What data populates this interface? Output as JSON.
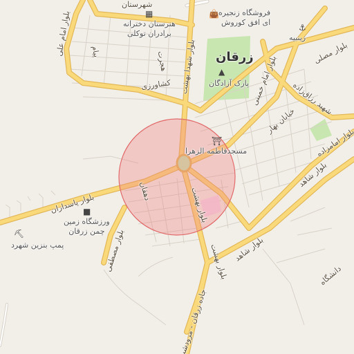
{
  "map": {
    "city_label": "زرقان",
    "highlight": {
      "fill": "#f08080",
      "stroke": "#e06a6a"
    },
    "colors": {
      "background": "#f2efe9",
      "major_road": "#f9d97a",
      "major_road_casing": "#e2b85a",
      "minor_road": "#ffffff",
      "minor_road_casing": "#d8d2c8",
      "park": "#c8e6b0"
    },
    "road_labels": {
      "shohada_north": "بلوار شهدا بهشت",
      "emam_ali": "بلوار امام علی",
      "emam_khomeini": "بلوار امام خمینی",
      "pasdaran": "بلوار پاسداران",
      "shahed": "بلوار شاهد",
      "shahed_se": "بلوار شاهد",
      "emamzadeh": "بلوار امامزاده",
      "mostafa": "بلوار مصطفی",
      "bahar": "خیابان بهار",
      "razzaqzadeh": "شهید رزاق‌زاده",
      "mosalla": "بلوار مصلی",
      "behesht": "بلوار بهشت",
      "behesht2": "بلوار بهشت",
      "jadde": "جاده زرقان - مرودشت",
      "dehghan": "دهقان",
      "keshavarzi": "کشاورزی",
      "hejrat": "هجرت",
      "payam": "پیام",
      "danesh": "دانشگاه",
      "shahrestan": "شهرستان"
    },
    "pois": {
      "school": "هنرستان دخترانه\nبرادران توکلی",
      "store": "فروشگاه زنجیره\nای افق کوروش",
      "zinbieh": "زینبیه",
      "park": "پارک آزادگان",
      "mosque": "مسجدفاطمه الزهرا",
      "sports": "ورزشگاه زمین\nچمن زرقان",
      "fuel": "پمپ بنزین شهرد"
    },
    "icons": {
      "school": "school-icon",
      "store": "shop-icon",
      "zinbieh": "religious-site-icon",
      "park": "tree-icon",
      "mosque": "mosque-icon",
      "sports": "stadium-icon",
      "fuel": "fuel-icon"
    }
  }
}
